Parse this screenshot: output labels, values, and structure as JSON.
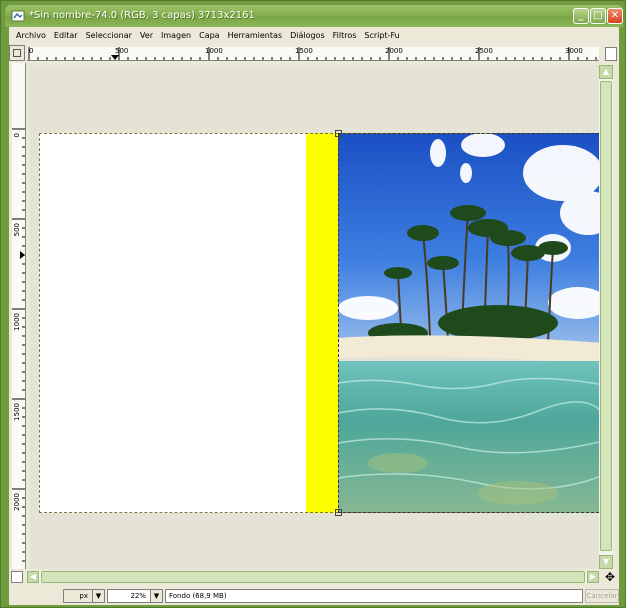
{
  "window": {
    "title": "*Sin nombre-74.0 (RGB, 3 capas) 3713x2161",
    "buttons": {
      "minimize": "_",
      "maximize": "□",
      "close": "✕"
    },
    "accent": "#86b04f"
  },
  "menu": {
    "items": [
      "Archivo",
      "Editar",
      "Seleccionar",
      "Ver",
      "Imagen",
      "Capa",
      "Herramientas",
      "Diálogos",
      "Filtros",
      "Script-Fu"
    ]
  },
  "rulers": {
    "horizontal": [
      "0",
      "500",
      "1000",
      "1500",
      "2000",
      "2500",
      "3000"
    ],
    "vertical": [
      "0",
      "500",
      "1000",
      "1500",
      "2000"
    ]
  },
  "canvas": {
    "layer_colors": {
      "background": "#ffffff",
      "strip": "#ffff00"
    },
    "photo_description_icon": "beach-palm-photo"
  },
  "statusbar": {
    "unit": "px",
    "zoom": "22%",
    "message": "Fondo (68,9 MB)",
    "cancel_label": "Cancelar"
  }
}
